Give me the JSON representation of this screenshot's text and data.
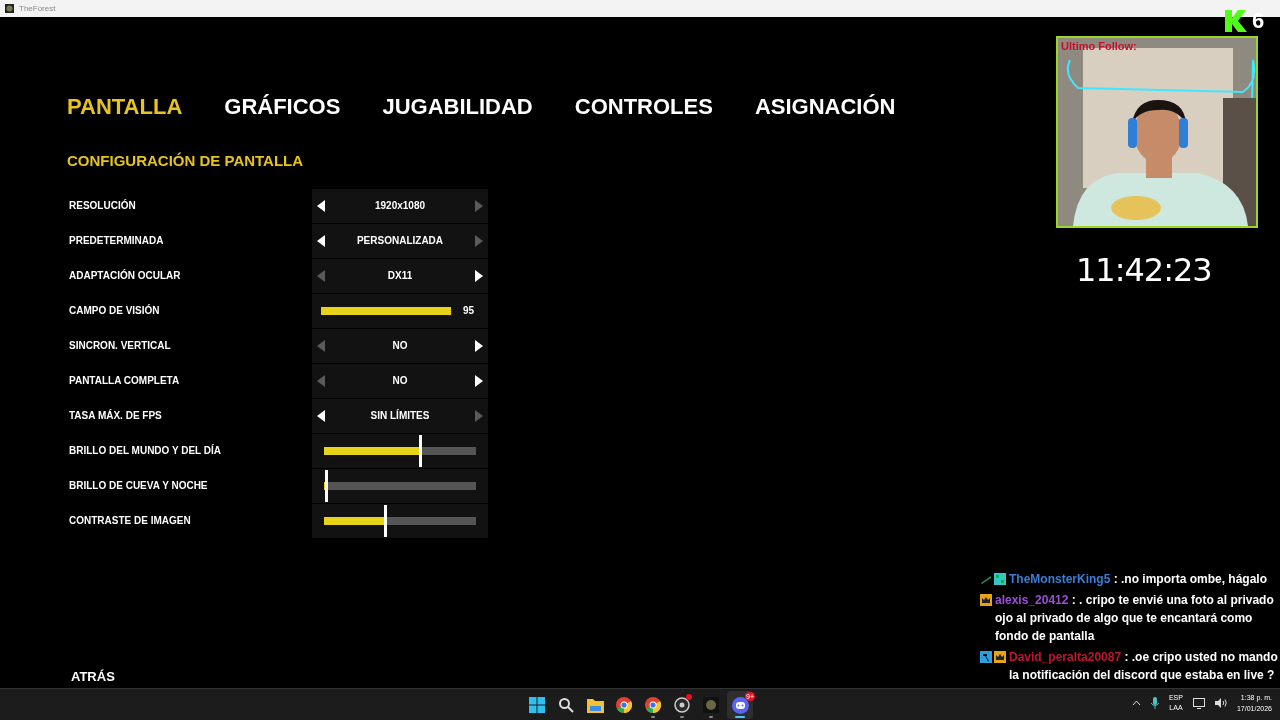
{
  "window": {
    "title": "TheForest"
  },
  "tabs": [
    {
      "label": "PANTALLA",
      "selected": true
    },
    {
      "label": "GRÁFICOS",
      "selected": false
    },
    {
      "label": "JUGABILIDAD",
      "selected": false
    },
    {
      "label": "CONTROLES",
      "selected": false
    },
    {
      "label": "ASIGNACIÓN",
      "selected": false
    }
  ],
  "section_title": "CONFIGURACIÓN DE PANTALLA",
  "settings": [
    {
      "label": "RESOLUCIÓN",
      "kind": "selector",
      "value": "1920x1080",
      "left_enabled": true,
      "right_enabled": false
    },
    {
      "label": "PREDETERMINADA",
      "kind": "selector",
      "value": "PERSONALIZADA",
      "left_enabled": true,
      "right_enabled": false
    },
    {
      "label": "ADAPTACIÓN OCULAR",
      "kind": "selector",
      "value": "DX11",
      "left_enabled": false,
      "right_enabled": true
    },
    {
      "label": "CAMPO DE VISIÓN",
      "kind": "bar",
      "level": 1,
      "reading": "95"
    },
    {
      "label": "SINCRON. VERTICAL",
      "kind": "selector",
      "value": "NO",
      "left_enabled": false,
      "right_enabled": true
    },
    {
      "label": "PANTALLA COMPLETA",
      "kind": "selector",
      "value": "NO",
      "left_enabled": false,
      "right_enabled": true
    },
    {
      "label": "TASA MÁX. DE FPS",
      "kind": "selector",
      "value": "SIN LÍMITES",
      "left_enabled": true,
      "right_enabled": false
    },
    {
      "label": "BRILLO DEL MUNDO Y DEL DÍA",
      "kind": "slider",
      "level": 0.63
    },
    {
      "label": "BRILLO DE CUEVA Y NOCHE",
      "kind": "slider",
      "level": 0.01
    },
    {
      "label": "CONTRASTE DE IMAGEN",
      "kind": "slider",
      "level": 0.4
    }
  ],
  "back_label": "ATRÁS",
  "overlay": {
    "follow_label": "Ultimo Follow:",
    "clock": "11:42:23",
    "counter": "6"
  },
  "chat": [
    {
      "badges": [
        {
          "kind": "sword"
        },
        {
          "kind": "tile"
        }
      ],
      "user": "TheMonsterKing5",
      "color": "#3b7dd8",
      "text": ": .no importa ombe, hágalo"
    },
    {
      "badges": [
        {
          "kind": "crown"
        }
      ],
      "user": "alexis_20412",
      "color": "#9b4fd6",
      "text": ": . cripo te envié una foto al privado ojo al privado de algo que te encantará como fondo de pantalla"
    },
    {
      "badges": [
        {
          "kind": "hammer"
        },
        {
          "kind": "crown"
        }
      ],
      "user": "David_peralta20087",
      "color": "#c0172b",
      "text": ": .oe cripo usted no mando la notificación del discord que estaba en live ?"
    }
  ],
  "taskbar": [
    {
      "kind": "start",
      "running": false,
      "active": false,
      "notify": false
    },
    {
      "kind": "search",
      "running": false,
      "active": false,
      "notify": false
    },
    {
      "kind": "folder",
      "running": false,
      "active": false,
      "notify": false
    },
    {
      "kind": "browser",
      "running": false,
      "active": false,
      "notify": false
    },
    {
      "kind": "browser",
      "running": true,
      "active": false,
      "notify": false
    },
    {
      "kind": "recorder",
      "running": true,
      "active": false,
      "notify": true
    },
    {
      "kind": "game",
      "running": true,
      "active": false,
      "notify": false
    },
    {
      "kind": "chat",
      "running": true,
      "active": true,
      "notify": false,
      "badge": "9+"
    }
  ],
  "tray": {
    "lang": "ESP",
    "layout": "LAA",
    "time": "1:38 p. m.",
    "date": "17/01/2026"
  }
}
